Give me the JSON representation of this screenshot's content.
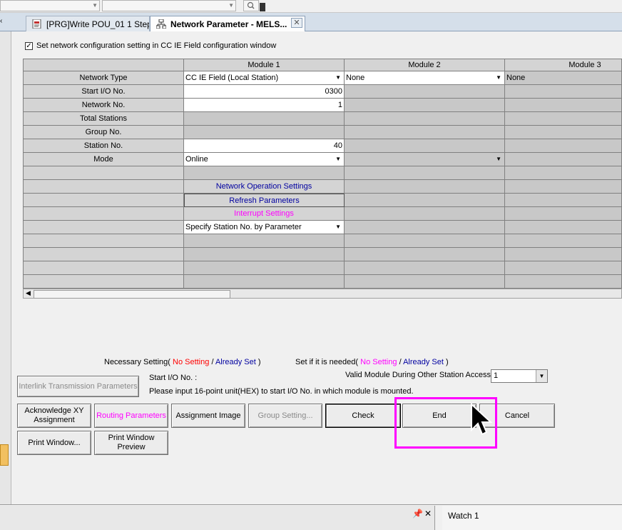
{
  "tabs": [
    {
      "label": "[PRG]Write POU_01 1 Step"
    },
    {
      "label": "Network Parameter - MELS..."
    }
  ],
  "dialog": {
    "checkbox_label": "Set network configuration setting in CC IE Field configuration window",
    "grid": {
      "columns": [
        "Module 1",
        "Module 2",
        "Module 3"
      ],
      "row_labels": [
        "Network Type",
        "Start I/O No.",
        "Network No.",
        "Total Stations",
        "Group No.",
        "Station No.",
        "Mode"
      ],
      "module1": {
        "network_type": "CC IE Field (Local Station)",
        "start_io": "0300",
        "network_no": "1",
        "station_no": "40",
        "mode": "Online",
        "network_operation_settings": "Network Operation Settings",
        "refresh_parameters": "Refresh Parameters",
        "interrupt_settings": "Interrupt Settings",
        "station_setting": "Specify Station No. by Parameter"
      },
      "module2": {
        "network_type": "None"
      },
      "module3": {
        "network_type": "None"
      }
    },
    "legend": {
      "necessary_prefix": "Necessary Setting(",
      "necessary_no": "No Setting",
      "slash1": "/",
      "necessary_already": "Already Set",
      "necessary_suffix": ")",
      "ifneeded_prefix": "Set if it is needed(",
      "ifneeded_no": "No Setting",
      "slash2": "/",
      "ifneeded_already": "Already Set",
      "ifneeded_suffix": ")"
    },
    "valid_module_label": "Valid Module During Other Station Access",
    "valid_module_value": "1",
    "info_title": "Start I/O No. :",
    "info_text": "Please input 16-point unit(HEX) to start I/O No. in which module is mounted.",
    "buttons": {
      "interlink": "Interlink Transmission Parameters",
      "acknowledge_xy": "Acknowledge XY Assignment",
      "routing": "Routing Parameters",
      "assignment_image": "Assignment Image",
      "group_setting": "Group Setting...",
      "check": "Check",
      "end": "End",
      "cancel": "Cancel",
      "print_window": "Print Window...",
      "print_preview": "Print Window Preview"
    }
  },
  "bottom": {
    "watch_label": "Watch 1",
    "pin_icon": "pin-icon",
    "close_icon": "close-icon"
  },
  "colors": {
    "highlight": "#ff00ff",
    "link_blue": "#0000a0",
    "no_setting_red": "#ff0000",
    "pink": "#ff00ff"
  }
}
